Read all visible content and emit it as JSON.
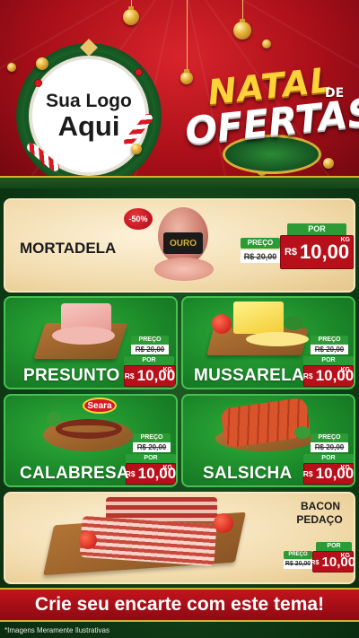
{
  "header": {
    "logo_line1": "Sua Logo",
    "logo_line2": "Aqui",
    "title_natal": "NATAL",
    "title_de": "DE",
    "title_ofertas": "OFERTAS"
  },
  "featured": {
    "name": "MORTADELA",
    "discount_badge": "-50%",
    "brand_on_pack": "OURO",
    "preco_label": "PREÇO",
    "old_price": "R$ 20,00",
    "por_label": "POR",
    "currency": "R$",
    "new_price": "10,00",
    "unit": "KG"
  },
  "grid": [
    {
      "name": "PRESUNTO",
      "preco_label": "PREÇO",
      "old_price": "R$ 20,00",
      "por_label": "POR",
      "currency": "R$",
      "new_price": "10,00",
      "unit": "KG"
    },
    {
      "name": "MUSSARELA",
      "preco_label": "PREÇO",
      "old_price": "R$ 20,00",
      "por_label": "POR",
      "currency": "R$",
      "new_price": "10,00",
      "unit": "KG"
    },
    {
      "name": "CALABRESA",
      "brand_badge": "Seara",
      "preco_label": "PREÇO",
      "old_price": "R$ 20,00",
      "por_label": "POR",
      "currency": "R$",
      "new_price": "10,00",
      "unit": "KG"
    },
    {
      "name": "SALSICHA",
      "preco_label": "PREÇO",
      "old_price": "R$ 20,00",
      "por_label": "POR",
      "currency": "R$",
      "new_price": "10,00",
      "unit": "KG"
    }
  ],
  "bacon": {
    "name_line1": "BACON",
    "name_line2": "PEDAÇO",
    "preco_label": "PREÇO",
    "old_price": "R$ 20,00",
    "por_label": "POR",
    "currency": "R$",
    "new_price": "10,00",
    "unit": "KG"
  },
  "footer": {
    "cta": "Crie seu encarte com este tema!",
    "disclaimer": "*Imagens Meramente Ilustrativas"
  },
  "colors": {
    "header_red": "#b8101a",
    "gold": "#d4af37",
    "green_card": "#1c8a2a",
    "beige_card": "#f2dcae",
    "price_red": "#b8101a",
    "price_green": "#2c9b35"
  },
  "icons": [
    "ornament-icon",
    "wreath-icon",
    "candy-cane-icon"
  ]
}
